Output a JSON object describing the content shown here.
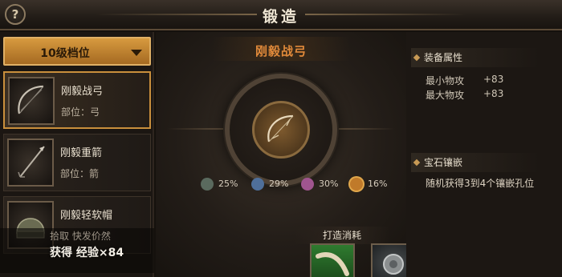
{
  "header": {
    "title": "锻造",
    "help_label": "?"
  },
  "left": {
    "tier_label": "10级档位",
    "items": [
      {
        "name": "刚毅战弓",
        "slot": "部位：弓",
        "icon": "bow-icon"
      },
      {
        "name": "刚毅重箭",
        "slot": "部位：箭",
        "icon": "arrow-icon"
      },
      {
        "name": "刚毅轻软帽",
        "slot": "",
        "icon": "helmet-icon"
      }
    ],
    "overlay_line1": "拾取 快发价然",
    "overlay_line2": "获得 经验×84"
  },
  "center": {
    "item_title": "刚毅战弓",
    "qualities": [
      {
        "pct": "25%",
        "color": "#5a6a5e"
      },
      {
        "pct": "29%",
        "color": "#4f6f9a"
      },
      {
        "pct": "30%",
        "color": "#a0558f"
      },
      {
        "pct": "16%",
        "color": "#c07a2a",
        "active": true
      }
    ],
    "cost_label": "打造消耗"
  },
  "right": {
    "attr_title": "装备属性",
    "stats": [
      {
        "label": "最小物攻",
        "value": "+83"
      },
      {
        "label": "最大物攻",
        "value": "+83"
      }
    ],
    "gem_title": "宝石镶嵌",
    "gem_desc": "随机获得3到4个镶嵌孔位"
  },
  "colors": {
    "accent": "#e28a3a",
    "tier_bg": "#c4852f",
    "selected_border": "#c98f3c"
  }
}
